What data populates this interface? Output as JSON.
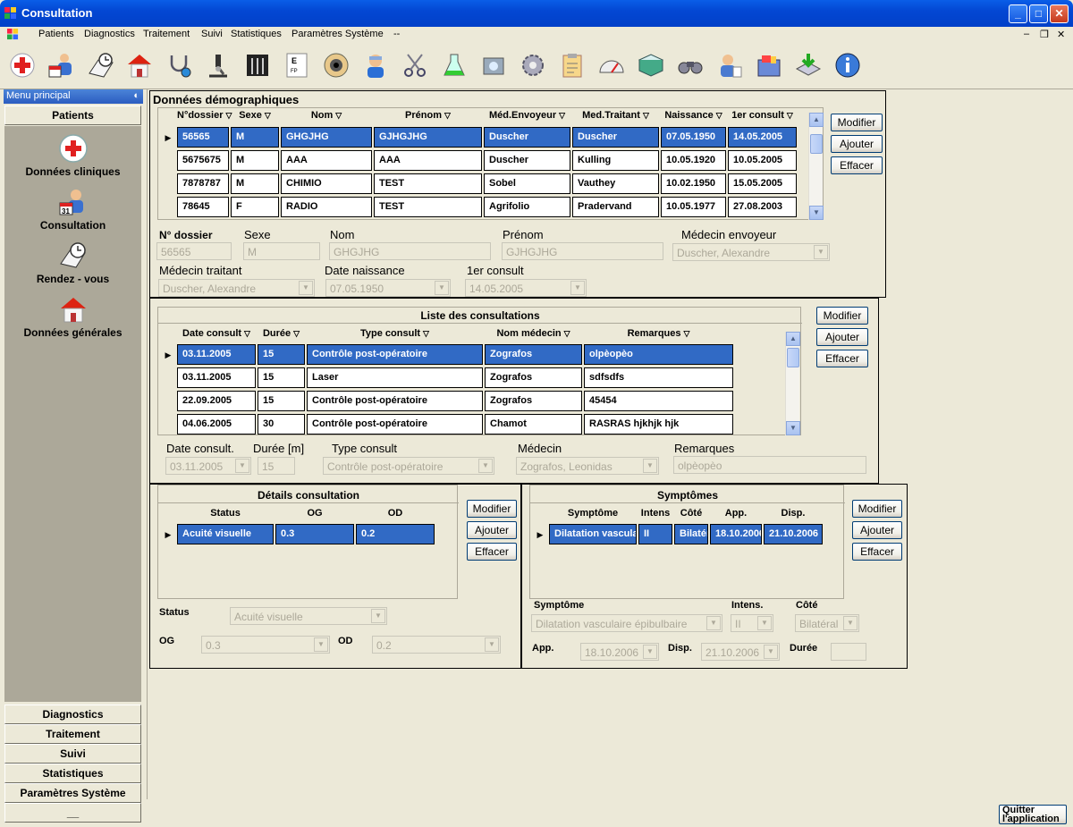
{
  "window": {
    "title": "Consultation"
  },
  "menu": [
    "Patients",
    "Diagnostics",
    "Traitement",
    "Suivi",
    "Statistiques",
    "Paramètres Système",
    "--"
  ],
  "toolbar_icons": [
    "add-patient-icon",
    "consultation-icon",
    "appointment-icon",
    "home-icon",
    "stethoscope-icon",
    "microscope-icon",
    "xray-icon",
    "eye-chart-icon",
    "eye-icon",
    "doctor-icon",
    "scissors-icon",
    "flask-icon",
    "lab-equipment-icon",
    "gear-icon",
    "clipboard-icon",
    "gauge-icon",
    "book-icon",
    "binoculars-icon",
    "user-settings-icon",
    "folders-icon",
    "download-icon",
    "info-icon"
  ],
  "left_menu": {
    "header": "Menu principal",
    "top_button": "Patients",
    "items": [
      "Données cliniques",
      "Consultation",
      "Rendez - vous",
      "Données générales"
    ],
    "bottom_buttons": [
      "Diagnostics",
      "Traitement",
      "Suivi",
      "Statistiques",
      "Paramètres Système",
      "__"
    ]
  },
  "demo": {
    "title": "Données démographiques",
    "columns": [
      "N°dossier",
      "Sexe",
      "Nom",
      "Prénom",
      "Méd.Envoyeur",
      "Med.Traitant",
      "Naissance",
      "1er consult"
    ],
    "rows": [
      [
        "56565",
        "M",
        "GHGJHG",
        "GJHGJHG",
        "Duscher",
        "Duscher",
        "07.05.1950",
        "14.05.2005"
      ],
      [
        "5675675",
        "M",
        "AAA",
        "AAA",
        "Duscher",
        "Kulling",
        "10.05.1920",
        "10.05.2005"
      ],
      [
        "7878787",
        "M",
        "CHIMIO",
        "TEST",
        "Sobel",
        "Vauthey",
        "10.02.1950",
        "15.05.2005"
      ],
      [
        "78645",
        "F",
        "RADIO",
        "TEST",
        "Agrifolio",
        "Pradervand",
        "10.05.1977",
        "27.08.2003"
      ]
    ],
    "buttons": [
      "Modifier",
      "Ajouter",
      "Effacer"
    ],
    "form": {
      "l_dossier": "N° dossier",
      "v_dossier": "56565",
      "l_sexe": "Sexe",
      "v_sexe": "M",
      "l_nom": "Nom",
      "v_nom": "GHGJHG",
      "l_prenom": "Prénom",
      "v_prenom": "GJHGJHG",
      "l_env": "Médecin envoyeur",
      "v_env": "Duscher, Alexandre",
      "l_trait": "Médecin traitant",
      "v_trait": "Duscher, Alexandre",
      "l_naiss": "Date naissance",
      "v_naiss": "07.05.1950",
      "l_first": "1er consult",
      "v_first": "14.05.2005"
    }
  },
  "consult": {
    "title": "Liste des consultations",
    "columns": [
      "Date consult",
      "Durée",
      "Type consult",
      "Nom médecin",
      "Remarques"
    ],
    "rows": [
      [
        "03.11.2005",
        "15",
        "Contrôle post-opératoire",
        "Zografos",
        "olpèopèo"
      ],
      [
        "03.11.2005",
        "15",
        "Laser",
        "Zografos",
        "sdfsdfs"
      ],
      [
        "22.09.2005",
        "15",
        "Contrôle post-opératoire",
        "Zografos",
        "45454"
      ],
      [
        "04.06.2005",
        "30",
        "Contrôle post-opératoire",
        "Chamot",
        "RASRAS hjkhjk hjk"
      ]
    ],
    "buttons": [
      "Modifier",
      "Ajouter",
      "Effacer"
    ],
    "form": {
      "l_date": "Date consult.",
      "v_date": "03.11.2005",
      "l_duree": "Durée [m]",
      "v_duree": "15",
      "l_type": "Type consult",
      "v_type": "Contrôle post-opératoire",
      "l_med": "Médecin",
      "v_med": "Zografos, Leonidas",
      "l_rem": "Remarques",
      "v_rem": "olpèopèo"
    }
  },
  "details": {
    "title": "Détails consultation",
    "columns": [
      "Status",
      "OG",
      "OD"
    ],
    "rows": [
      [
        "Acuité visuelle",
        "0.3",
        "0.2"
      ]
    ],
    "buttons": [
      "Modifier",
      "Ajouter",
      "Effacer"
    ],
    "form": {
      "l_status": "Status",
      "v_status": "Acuité visuelle",
      "l_og": "OG",
      "v_og": "0.3",
      "l_od": "OD",
      "v_od": "0.2"
    }
  },
  "symptoms": {
    "title": "Symptômes",
    "columns": [
      "Symptôme",
      "Intens",
      "Côté",
      "App.",
      "Disp."
    ],
    "rows": [
      [
        "Dilatation vasculaire épibulbaire",
        "II",
        "Bilatéral",
        "18.10.2006",
        "21.10.2006"
      ]
    ],
    "buttons": [
      "Modifier",
      "Ajouter",
      "Effacer"
    ],
    "form": {
      "l_sym": "Symptôme",
      "v_sym": "Dilatation vasculaire épibulbaire",
      "l_int": "Intens.",
      "v_int": "II",
      "l_cote": "Côté",
      "v_cote": "Bilatéral",
      "l_app": "App.",
      "v_app": "18.10.2006",
      "l_disp": "Disp.",
      "v_disp": "21.10.2006",
      "l_duree": "Durée",
      "v_duree": ""
    }
  },
  "quit_button": "Quitter l'application"
}
